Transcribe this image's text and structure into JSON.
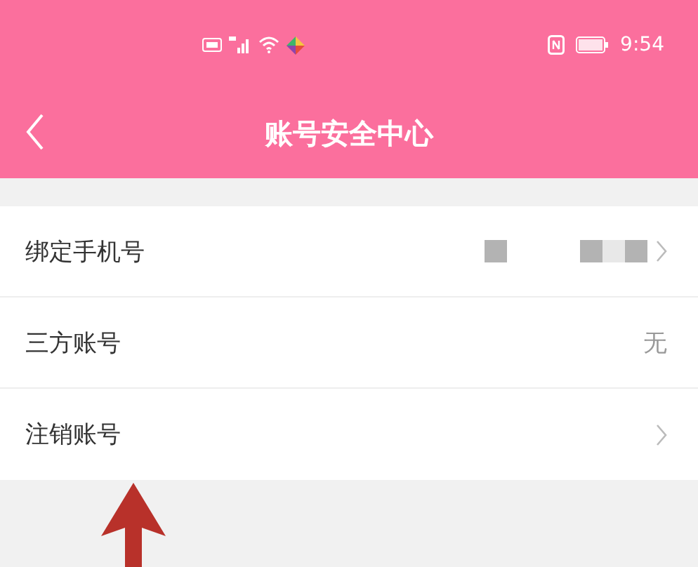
{
  "status_bar": {
    "time": "9:54"
  },
  "nav": {
    "title": "账号安全中心"
  },
  "rows": [
    {
      "label": "绑定手机号",
      "kind": "masked"
    },
    {
      "label": "三方账号",
      "kind": "value",
      "value": "无"
    },
    {
      "label": "注销账号",
      "kind": "arrow"
    }
  ],
  "annotation": {
    "kind": "arrow"
  }
}
